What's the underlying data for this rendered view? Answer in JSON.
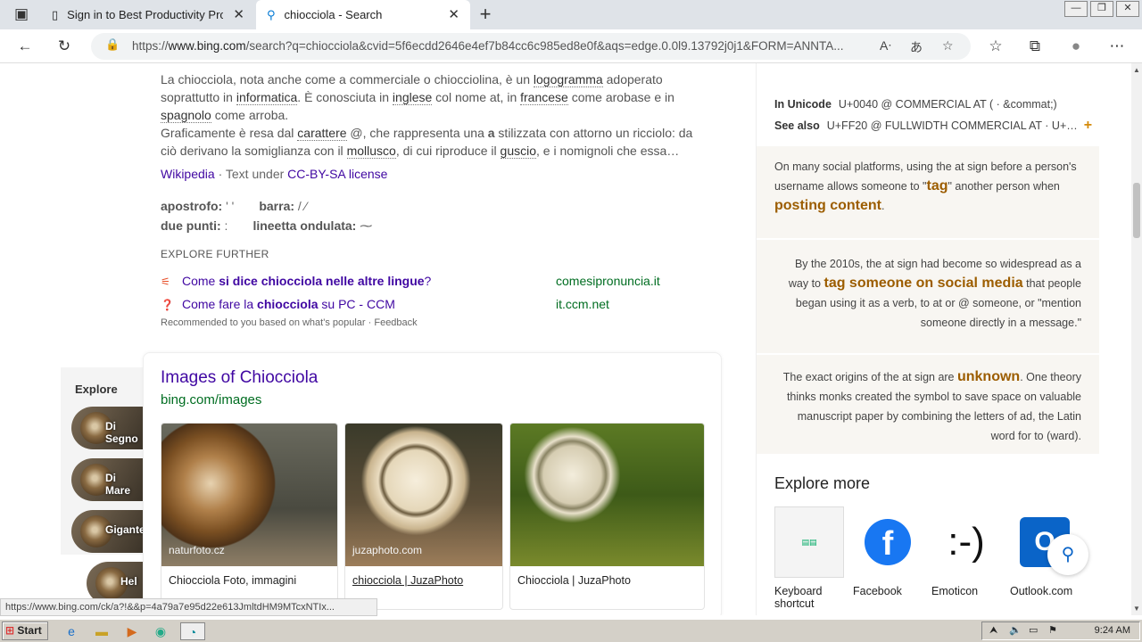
{
  "tabs": [
    {
      "title": "Sign in to Best Productivity Provi",
      "icon": "page-icon"
    },
    {
      "title": "chiocciola - Search",
      "icon": "search-icon"
    }
  ],
  "new_tab": "+",
  "address": {
    "prefix": "https://",
    "host": "www.bing.com",
    "path": "/search?q=chiocciola&cvid=5f6ecdd2646e4ef7b84cc6c985ed8e0f&aqs=edge.0.0l9.13792j0j1&FORM=ANNTA..."
  },
  "wiki": {
    "p1_a": "La chiocciola, nota anche come a commerciale o chiocciolina, è un ",
    "p1_l1": "logogramma",
    "p1_b": " adoperato soprattutto in ",
    "p1_l2": "informatica",
    "p1_c": ". È conosciuta in ",
    "p1_l3": "inglese",
    "p1_d": " col nome at, in ",
    "p1_l4": "francese",
    "p1_e": " come arobase e in ",
    "p1_l5": "spagnolo",
    "p1_f": " come arroba.",
    "p2_a": "Graficamente è resa dal ",
    "p2_l1": "carattere",
    "p2_b": " @, che rappresenta una ",
    "p2_l2": "a",
    "p2_c": " stilizzata con attorno un ricciolo: da ciò derivano la somiglianza con il ",
    "p2_l3": "mollusco",
    "p2_d": ", di cui riproduce il ",
    "p2_l4": "guscio",
    "p2_e": ", e i nomignoli che essa…",
    "source": "Wikipedia",
    "license_pre": " · Text under ",
    "license": "CC-BY-SA license"
  },
  "facts": [
    {
      "label": "apostrofo:",
      "value": " ' '"
    },
    {
      "label": "barra:",
      "value": " / ⁄"
    },
    {
      "label": "due punti:",
      "value": " :"
    },
    {
      "label": "lineetta ondulata:",
      "value": " ⁓"
    }
  ],
  "explore_further": {
    "heading": "EXPLORE FURTHER",
    "items": [
      {
        "pre": "Come ",
        "bold1": "si dice chiocciola nelle altre lingue",
        "post": "?",
        "source": "comesipronuncia.it"
      },
      {
        "pre": "Come fare la ",
        "bold1": "chiocciola",
        "post": " su PC - CCM",
        "source": "it.ccm.net"
      }
    ],
    "note": "Recommended to you based on what's popular · Feedback"
  },
  "explore_side": {
    "title": "Explore",
    "items": [
      "Di Segno",
      "Di Mare",
      "Gigante",
      "Hel"
    ]
  },
  "images": {
    "title": "Images of Chiocciola",
    "source": "bing.com/images",
    "items": [
      {
        "caption": "Chiocciola Foto, immagini",
        "watermark": "naturfoto.cz"
      },
      {
        "caption": "chiocciola | JuzaPhoto",
        "watermark": "juzaphoto.com"
      },
      {
        "caption": "Chiocciola | JuzaPhoto",
        "watermark": ""
      }
    ]
  },
  "rail": {
    "unicode_label": "In Unicode",
    "unicode_value": "U+0040 @ COMMERCIAL AT ( · &commat;)",
    "seealso_label": "See also",
    "seealso_value": "U+FF20 @ FULLWIDTH COMMERCIAL AT · U+…",
    "fact1": {
      "a": "On many social platforms, using the at sign before a person's username allows someone to \"",
      "h1": "tag",
      "b": "\" another person when ",
      "h2": "posting content",
      "c": "."
    },
    "fact2": {
      "a": "By the 2010s, the at sign had become so widespread as a way to ",
      "h1": "tag someone on social media",
      "b": " that people began using it as a verb, to at or @ someone, or \"mention someone directly in a message.\""
    },
    "fact3": {
      "a": "The exact origins of the at sign are ",
      "h1": "unknown",
      "b": ". One theory thinks monks created the symbol to save space on valuable manuscript paper by combining the letters of ad, the Latin word for to (ward)."
    },
    "explore_more": "Explore more",
    "em_items": [
      "Keyboard shortcut",
      "Facebook",
      "Emoticon",
      "Outlook.com"
    ]
  },
  "status_url": "https://www.bing.com/ck/a?!&&p=4a79a7e95d22e613JmltdHM9MTcxNTIx...",
  "taskbar": {
    "start": "Start",
    "clock": "9:24 AM"
  },
  "colors": {
    "link": "#4007a2",
    "source": "#006d21",
    "accent": "#9c5d00"
  }
}
